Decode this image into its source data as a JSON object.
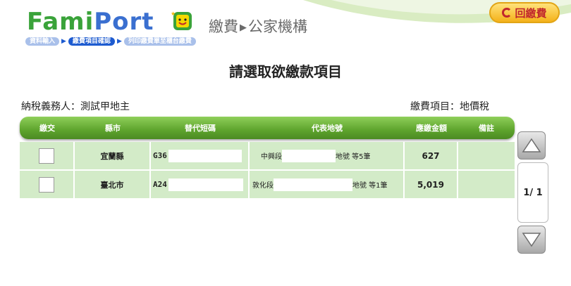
{
  "header": {
    "logo_part1": "Fami",
    "logo_part2": "Port",
    "breadcrumb_main": "繳費",
    "breadcrumb_sub": "公家機構",
    "steps": [
      {
        "label": "資料輸入",
        "state": "done"
      },
      {
        "label": "繳費項目確認",
        "state": "active"
      },
      {
        "label": "列印繳費單至櫃台繳費",
        "state": "pending"
      }
    ],
    "back_button_label": "回繳費"
  },
  "page_title": "請選取欲繳款項目",
  "taxpayer": {
    "label": "納稅義務人：",
    "value": "測試甲地主"
  },
  "tax_item": {
    "label": "繳費項目：",
    "value": "地價稅"
  },
  "table": {
    "headers": [
      "繳交",
      "縣市",
      "替代短碼",
      "代表地號",
      "應繳金額",
      "備註"
    ],
    "rows": [
      {
        "county": "宜蘭縣",
        "code_prefix": "G36",
        "section": "中興段",
        "lot_suffix": "地號 等5筆",
        "amount": "627",
        "note": ""
      },
      {
        "county": "臺北市",
        "code_prefix": "A24",
        "section": "敦化段",
        "lot_suffix": "地號 等1筆",
        "amount": "5,019",
        "note": ""
      }
    ]
  },
  "pagination": {
    "label": "1/ 1"
  },
  "colors": {
    "accent_green": "#5ea42d",
    "row_bg": "#d3ebc8",
    "brand_red": "#c1272d"
  }
}
